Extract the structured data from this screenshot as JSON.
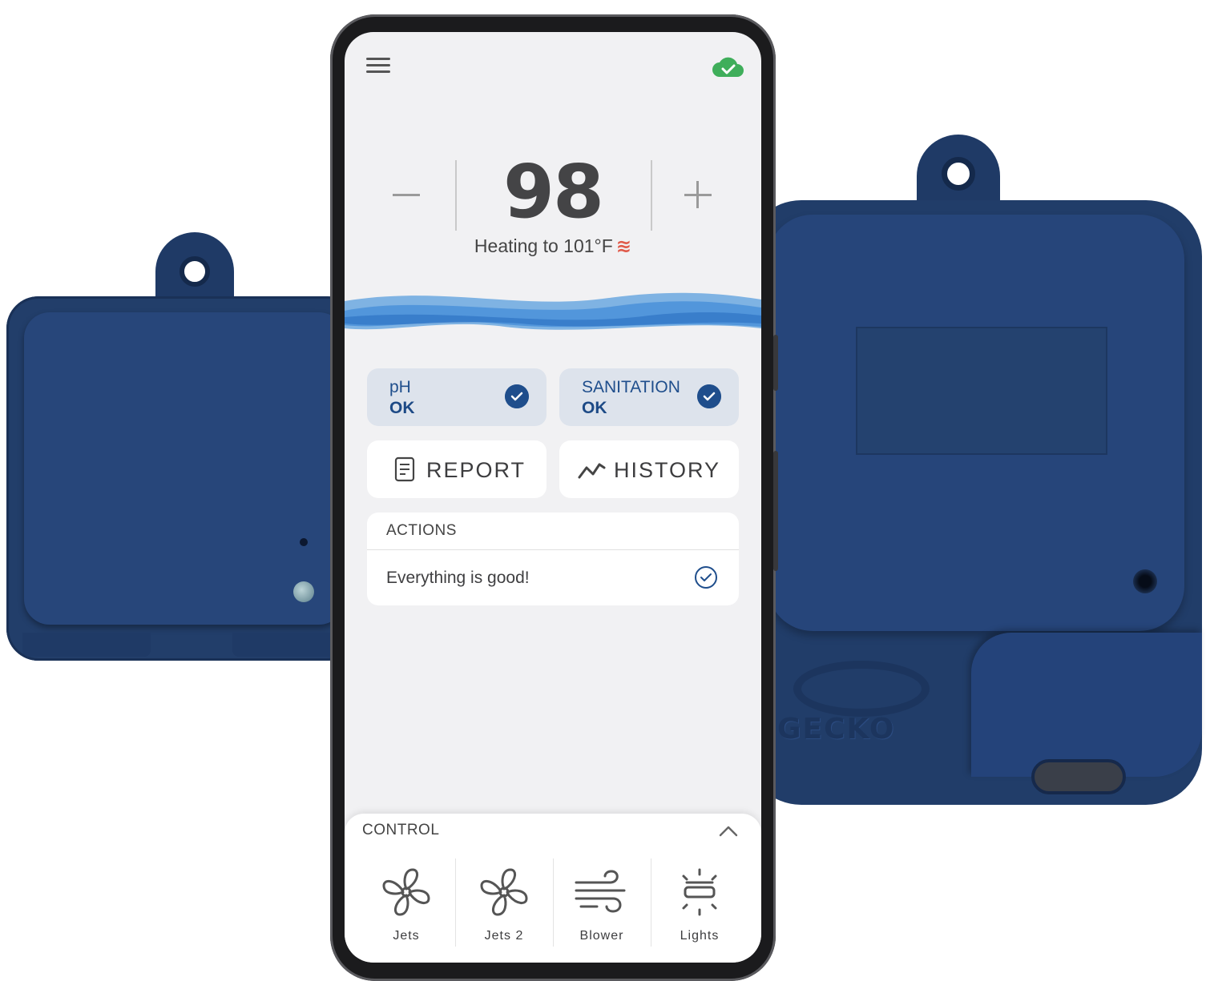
{
  "app": {
    "temperature": "98",
    "heating_text": "Heating to 101°F",
    "heating_icon": "≋"
  },
  "status": [
    {
      "label": "pH",
      "value": "OK",
      "icon": "check-circle-icon"
    },
    {
      "label": "SANITATION",
      "value": "OK",
      "icon": "check-circle-icon"
    }
  ],
  "buttons": {
    "report": "REPORT",
    "history": "HISTORY"
  },
  "actions": {
    "header": "ACTIONS",
    "message": "Everything is good!"
  },
  "control": {
    "header": "CONTROL",
    "items": [
      {
        "label": "Jets",
        "icon": "fan-icon"
      },
      {
        "label": "Jets 2",
        "icon": "fan-icon"
      },
      {
        "label": "Blower",
        "icon": "wind-icon"
      },
      {
        "label": "Lights",
        "icon": "light-icon"
      }
    ]
  },
  "hardware": {
    "brand": "GECKO"
  },
  "colors": {
    "accent": "#1f4e8c",
    "cloud_ok": "#3fae5a",
    "heat": "#e05a4a",
    "device_blue": "#223e6a"
  }
}
